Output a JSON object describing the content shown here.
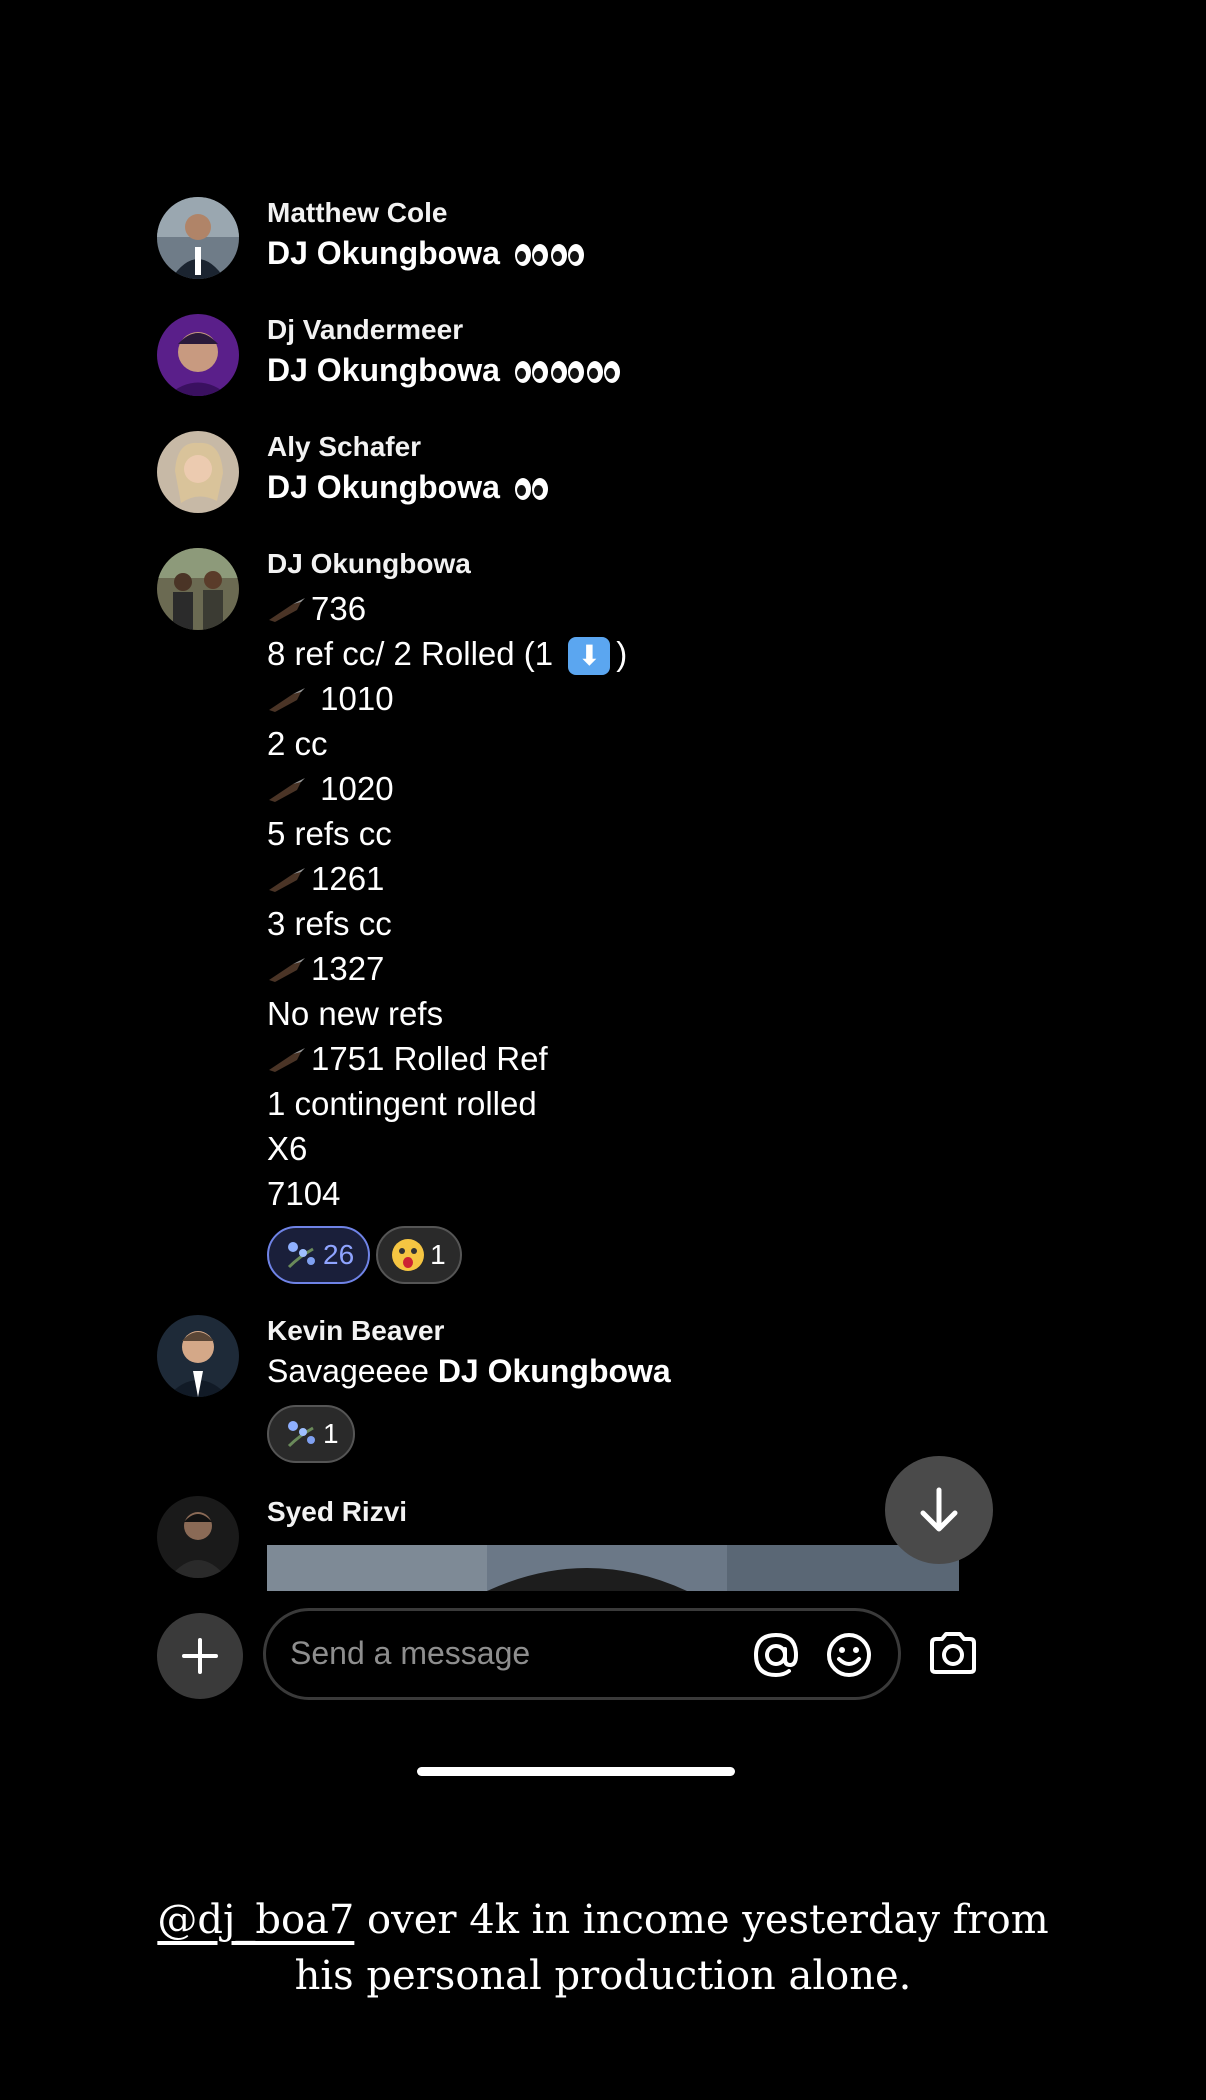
{
  "messages": [
    {
      "name": "Matthew Cole",
      "text": "DJ Okungbowa",
      "eye_pairs": 2
    },
    {
      "name": "Dj Vandermeer",
      "text": "DJ Okungbowa",
      "eye_pairs": 3
    },
    {
      "name": "Aly Schafer",
      "text": "DJ Okungbowa",
      "eye_pairs": 1
    },
    {
      "name": "DJ Okungbowa",
      "lines": [
        "736",
        "8 ref cc/ 2 Rolled (1",
        ")",
        "1010",
        "2 cc",
        "1020",
        "5 refs cc",
        "1261",
        "3 refs cc",
        "1327",
        "No new refs",
        "1751 Rolled Ref",
        "1 contingent rolled",
        "X6",
        "7104"
      ],
      "reactions": [
        {
          "icon": "flower-emoji",
          "count": "26"
        },
        {
          "icon": "astonished-face-emoji",
          "count": "1"
        }
      ]
    },
    {
      "name": "Kevin Beaver",
      "text_plain": "Savageeee",
      "text_bold": "DJ Okungbowa",
      "reactions": [
        {
          "icon": "flower-emoji",
          "count": "1"
        }
      ]
    },
    {
      "name": "Syed Rizvi"
    }
  ],
  "composer": {
    "placeholder": "Send a message"
  },
  "caption": {
    "mention": "@dj_boa7",
    "line1_rest": " over 4k in income yesterday from",
    "line2": "his personal production alone."
  }
}
